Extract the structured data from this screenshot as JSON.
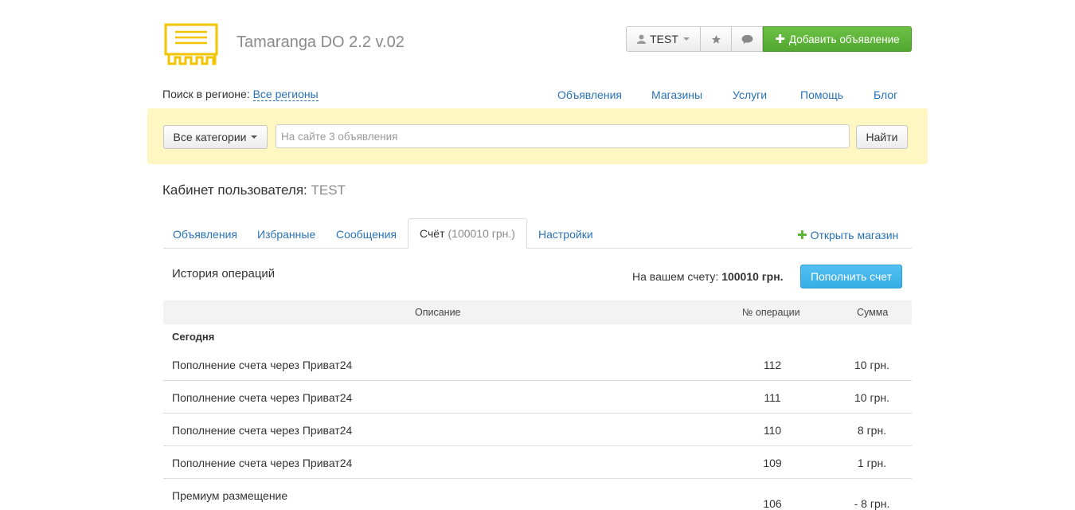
{
  "header": {
    "site_title": "Tamaranga DO 2.2 v.02",
    "user_label": "TEST",
    "add_listing_label": "Добавить объявление"
  },
  "region": {
    "label": "Поиск в регионе:",
    "value": "Все регионы"
  },
  "nav": [
    {
      "label": "Объявления"
    },
    {
      "label": "Магазины"
    },
    {
      "label": "Услуги"
    },
    {
      "label": "Помощь"
    },
    {
      "label": "Блог"
    }
  ],
  "search": {
    "category_label": "Все категории",
    "placeholder": "На сайте 3 объявления",
    "submit_label": "Найти"
  },
  "cabinet": {
    "title": "Кабинет пользователя:",
    "username": "TEST",
    "tabs": [
      {
        "label": "Объявления"
      },
      {
        "label": "Избранные"
      },
      {
        "label": "Сообщения"
      },
      {
        "label": "Счёт",
        "extra": "(100010 грн.)"
      },
      {
        "label": "Настройки"
      }
    ],
    "open_shop_label": "Открыть магазин"
  },
  "history": {
    "title": "История операций",
    "balance_label": "На вашем счету:",
    "balance_value": "100010 грн.",
    "topup_label": "Пополнить счет",
    "columns": [
      "Описание",
      "№ операции",
      "Сумма"
    ],
    "group_label": "Сегодня",
    "rows": [
      {
        "desc": "Пополнение счета через Приват24",
        "num": "112",
        "sum": "10 грн."
      },
      {
        "desc": "Пополнение счета через Приват24",
        "num": "111",
        "sum": "10 грн."
      },
      {
        "desc": "Пополнение счета через Приват24",
        "num": "110",
        "sum": "8 грн."
      },
      {
        "desc": "Пополнение счета через Приват24",
        "num": "109",
        "sum": "1 грн."
      },
      {
        "desc": "Премиум размещение",
        "num": "106",
        "sum": "- 8 грн."
      }
    ]
  },
  "colors": {
    "link": "#2a72b5",
    "add_button": "#5cb336",
    "topup_button": "#3db3ea",
    "search_bg": "#fff7c2"
  }
}
